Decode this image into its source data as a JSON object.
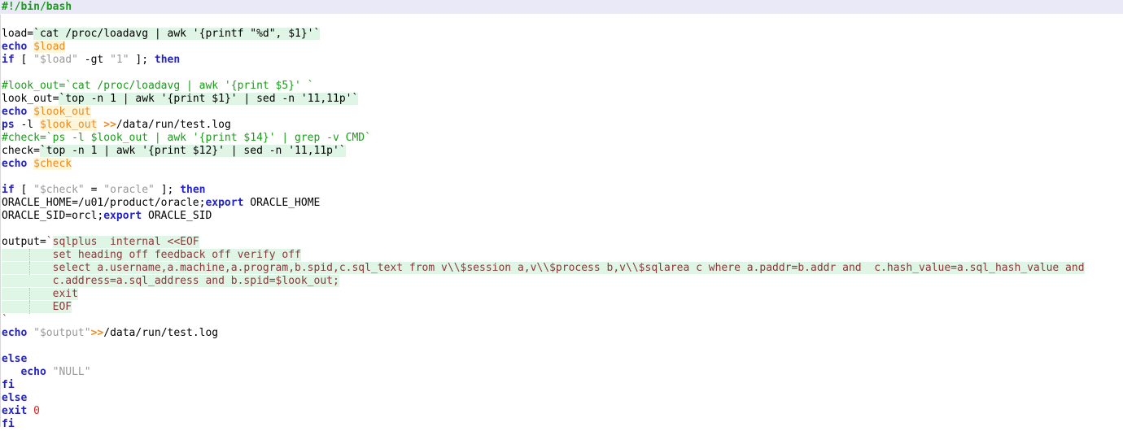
{
  "document": {
    "kind": "shell-script-source-listing",
    "language": "bash",
    "title": "#!/bin/bash",
    "colors": {
      "background": "#ffffff",
      "shebang_band": "#e9e9f8",
      "comment": "#1a9c1a",
      "keyword": "#2222cc",
      "variable": "#ef8a22",
      "variable_highlight": "#fdf6db",
      "string": "#999999",
      "number": "#dd2222",
      "command_substitution_text": "#8a3a3a",
      "command_substitution_highlight": "#dff5e6",
      "indent_guide": "#b9b9b9"
    }
  },
  "lines": [
    {
      "id": "l1",
      "banner": true,
      "guide": false,
      "tokens": [
        {
          "t": "#!/bin/bash",
          "c": "tok-shebang"
        }
      ]
    },
    {
      "id": "l2",
      "banner": false,
      "guide": false,
      "tokens": []
    },
    {
      "id": "l3",
      "banner": false,
      "guide": false,
      "tokens": [
        {
          "t": "load=",
          "c": "tok-plain"
        },
        {
          "t": "`cat /proc/loadavg | awk '{printf \"%d\", $1}'`",
          "c": "tok-subplain"
        }
      ]
    },
    {
      "id": "l4",
      "banner": false,
      "guide": false,
      "tokens": [
        {
          "t": "echo ",
          "c": "tok-builtin"
        },
        {
          "t": "$load",
          "c": "tok-var"
        }
      ]
    },
    {
      "id": "l5",
      "banner": false,
      "guide": false,
      "tokens": [
        {
          "t": "if",
          "c": "tok-keyword"
        },
        {
          "t": " [ ",
          "c": "tok-plain"
        },
        {
          "t": "\"$load\"",
          "c": "tok-string"
        },
        {
          "t": " -gt ",
          "c": "tok-plain"
        },
        {
          "t": "\"1\"",
          "c": "tok-string"
        },
        {
          "t": " ]; ",
          "c": "tok-plain"
        },
        {
          "t": "then",
          "c": "tok-keyword"
        }
      ]
    },
    {
      "id": "l6",
      "banner": false,
      "guide": false,
      "tokens": []
    },
    {
      "id": "l7",
      "banner": false,
      "guide": false,
      "tokens": [
        {
          "t": "#look_out=`cat /proc/loadavg | awk '{print $5}' `",
          "c": "tok-comment"
        }
      ]
    },
    {
      "id": "l8",
      "banner": false,
      "guide": false,
      "tokens": [
        {
          "t": "look_out=",
          "c": "tok-plain"
        },
        {
          "t": "`top -n 1 | awk '{print $1}' | sed -n '11,11p'`",
          "c": "tok-subplain"
        }
      ]
    },
    {
      "id": "l9",
      "banner": false,
      "guide": false,
      "tokens": [
        {
          "t": "echo ",
          "c": "tok-builtin"
        },
        {
          "t": "$look_out",
          "c": "tok-var"
        }
      ]
    },
    {
      "id": "l10",
      "banner": false,
      "guide": false,
      "tokens": [
        {
          "t": "ps",
          "c": "tok-builtin"
        },
        {
          "t": " -l ",
          "c": "tok-plain"
        },
        {
          "t": "$look_out",
          "c": "tok-var"
        },
        {
          "t": " ",
          "c": "tok-plain"
        },
        {
          "t": ">>",
          "c": "tok-redirect"
        },
        {
          "t": "/data/run/test.log",
          "c": "tok-plain"
        }
      ]
    },
    {
      "id": "l11",
      "banner": false,
      "guide": false,
      "tokens": [
        {
          "t": "#check=`ps -l $look_out | awk '{print $14}' | grep -v CMD`",
          "c": "tok-comment"
        }
      ]
    },
    {
      "id": "l12",
      "banner": false,
      "guide": false,
      "tokens": [
        {
          "t": "check=",
          "c": "tok-plain"
        },
        {
          "t": "`top -n 1 | awk '{print $12}' | sed -n '11,11p'`",
          "c": "tok-subplain"
        }
      ]
    },
    {
      "id": "l13",
      "banner": false,
      "guide": false,
      "tokens": [
        {
          "t": "echo ",
          "c": "tok-builtin"
        },
        {
          "t": "$check",
          "c": "tok-var"
        }
      ]
    },
    {
      "id": "l14",
      "banner": false,
      "guide": false,
      "tokens": []
    },
    {
      "id": "l15",
      "banner": false,
      "guide": false,
      "tokens": [
        {
          "t": "if",
          "c": "tok-keyword"
        },
        {
          "t": " [ ",
          "c": "tok-plain"
        },
        {
          "t": "\"$check\"",
          "c": "tok-string"
        },
        {
          "t": " = ",
          "c": "tok-plain"
        },
        {
          "t": "\"oracle\"",
          "c": "tok-string"
        },
        {
          "t": " ]; ",
          "c": "tok-plain"
        },
        {
          "t": "then",
          "c": "tok-keyword"
        }
      ]
    },
    {
      "id": "l16",
      "banner": false,
      "guide": false,
      "tokens": [
        {
          "t": "ORACLE_HOME=/u01/product/oracle;",
          "c": "tok-plain"
        },
        {
          "t": "export",
          "c": "tok-keyword"
        },
        {
          "t": " ORACLE_HOME",
          "c": "tok-plain"
        }
      ]
    },
    {
      "id": "l17",
      "banner": false,
      "guide": false,
      "tokens": [
        {
          "t": "ORACLE_SID=orcl;",
          "c": "tok-plain"
        },
        {
          "t": "export",
          "c": "tok-keyword"
        },
        {
          "t": " ORACLE_SID",
          "c": "tok-plain"
        }
      ]
    },
    {
      "id": "l18",
      "banner": false,
      "guide": false,
      "tokens": []
    },
    {
      "id": "l19",
      "banner": false,
      "guide": false,
      "tokens": [
        {
          "t": "output=",
          "c": "tok-plain"
        },
        {
          "t": "`",
          "c": "tok-subtick"
        },
        {
          "t": "sqlplus  internal <<EOF",
          "c": "tok-sub"
        }
      ]
    },
    {
      "id": "l20",
      "banner": false,
      "guide": true,
      "tokens": [
        {
          "t": "        set heading off feedback off verify off",
          "c": "tok-sub"
        }
      ]
    },
    {
      "id": "l21",
      "banner": false,
      "guide": true,
      "tokens": [
        {
          "t": "        select a.username,a.machine,a.program,b.spid,c.sql_text from v\\\\$session a,v\\\\$process b,v\\\\$sqlarea c where a.paddr=b.addr and  c.hash_value=a.sql_hash_value and",
          "c": "tok-sub"
        }
      ]
    },
    {
      "id": "l22",
      "banner": false,
      "guide": false,
      "tokens": [
        {
          "t": "        c.address=a.sql_address and b.spid=$look_out;",
          "c": "tok-sub"
        }
      ]
    },
    {
      "id": "l23",
      "banner": false,
      "guide": true,
      "tokens": [
        {
          "t": "        exit",
          "c": "tok-sub"
        }
      ]
    },
    {
      "id": "l24",
      "banner": false,
      "guide": true,
      "tokens": [
        {
          "t": "        EOF",
          "c": "tok-sub"
        }
      ]
    },
    {
      "id": "l25",
      "banner": false,
      "guide": false,
      "tokens": [
        {
          "t": "`",
          "c": "tok-subtick"
        }
      ]
    },
    {
      "id": "l26",
      "banner": false,
      "guide": false,
      "tokens": [
        {
          "t": "echo ",
          "c": "tok-builtin"
        },
        {
          "t": "\"$output\"",
          "c": "tok-string"
        },
        {
          "t": ">>",
          "c": "tok-redirect"
        },
        {
          "t": "/data/run/test.log",
          "c": "tok-plain"
        }
      ]
    },
    {
      "id": "l27",
      "banner": false,
      "guide": false,
      "tokens": []
    },
    {
      "id": "l28",
      "banner": false,
      "guide": false,
      "tokens": [
        {
          "t": "else",
          "c": "tok-keyword"
        }
      ]
    },
    {
      "id": "l29",
      "banner": false,
      "guide": false,
      "tokens": [
        {
          "t": "   ",
          "c": "tok-plain"
        },
        {
          "t": "echo ",
          "c": "tok-builtin"
        },
        {
          "t": "\"NULL\"",
          "c": "tok-string"
        }
      ]
    },
    {
      "id": "l30",
      "banner": false,
      "guide": false,
      "tokens": [
        {
          "t": "fi",
          "c": "tok-keyword"
        }
      ]
    },
    {
      "id": "l31",
      "banner": false,
      "guide": false,
      "tokens": [
        {
          "t": "else",
          "c": "tok-keyword"
        }
      ]
    },
    {
      "id": "l32",
      "banner": false,
      "guide": false,
      "tokens": [
        {
          "t": "exit",
          "c": "tok-keyword"
        },
        {
          "t": " ",
          "c": "tok-plain"
        },
        {
          "t": "0",
          "c": "tok-number"
        }
      ]
    },
    {
      "id": "l33",
      "banner": false,
      "guide": false,
      "tokens": [
        {
          "t": "fi",
          "c": "tok-keyword"
        }
      ]
    }
  ]
}
